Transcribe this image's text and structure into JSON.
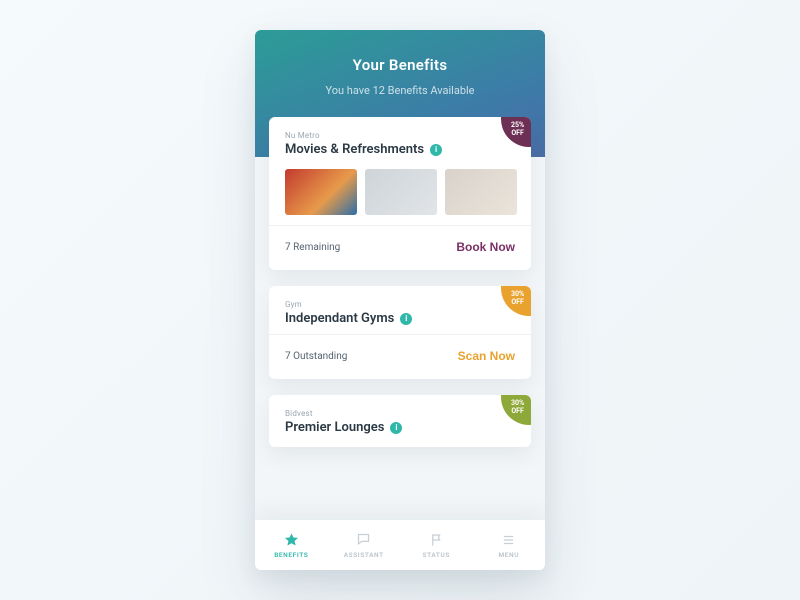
{
  "header": {
    "title": "Your Benefits",
    "subtitle": "You have 12 Benefits Available"
  },
  "cards": [
    {
      "supertitle": "Nu Metro",
      "title": "Movies & Refreshments",
      "badge_line1": "25%",
      "badge_line2": "OFF",
      "badge_color": "#6d2f54",
      "footer_status": "7 Remaining",
      "cta": "Book Now",
      "cta_class": "purple",
      "has_thumbs": true
    },
    {
      "supertitle": "Gym",
      "title": "Independant Gyms",
      "badge_line1": "30%",
      "badge_line2": "OFF",
      "badge_color": "#e9a22d",
      "footer_status": "7 Outstanding",
      "cta": "Scan Now",
      "cta_class": "orange",
      "has_thumbs": false
    },
    {
      "supertitle": "Bidvest",
      "title": "Premier Lounges",
      "badge_line1": "30%",
      "badge_line2": "OFF",
      "badge_color": "#8fa83a",
      "footer_status": "",
      "cta": "",
      "cta_class": "",
      "has_thumbs": false
    }
  ],
  "tabs": [
    {
      "label": "BENEFITS",
      "icon": "star",
      "active": true
    },
    {
      "label": "ASSISTANT",
      "icon": "chat",
      "active": false
    },
    {
      "label": "STATUS",
      "icon": "flag",
      "active": false
    },
    {
      "label": "MENU",
      "icon": "menu",
      "active": false
    }
  ]
}
